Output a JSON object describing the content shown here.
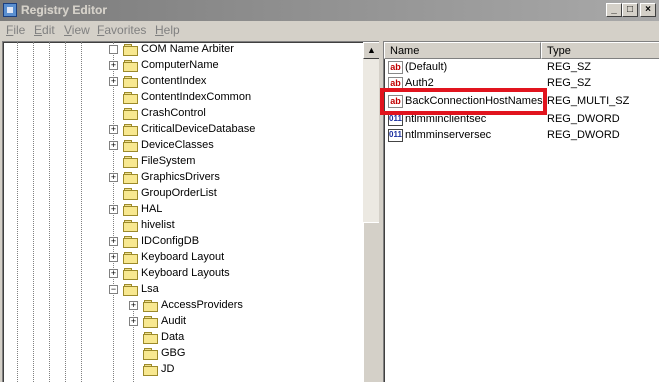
{
  "window": {
    "title": "Registry Editor",
    "controls": [
      "_",
      "□",
      "×"
    ]
  },
  "menu": [
    "File",
    "Edit",
    "View",
    "Favorites",
    "Help"
  ],
  "tree": {
    "items": [
      {
        "label": "COM Name Arbiter",
        "expander": ""
      },
      {
        "label": "ComputerName",
        "expander": "+"
      },
      {
        "label": "ContentIndex",
        "expander": "+"
      },
      {
        "label": "ContentIndexCommon",
        "expander": ""
      },
      {
        "label": "CrashControl",
        "expander": ""
      },
      {
        "label": "CriticalDeviceDatabase",
        "expander": "+"
      },
      {
        "label": "DeviceClasses",
        "expander": "+"
      },
      {
        "label": "FileSystem",
        "expander": ""
      },
      {
        "label": "GraphicsDrivers",
        "expander": "+"
      },
      {
        "label": "GroupOrderList",
        "expander": ""
      },
      {
        "label": "HAL",
        "expander": "+"
      },
      {
        "label": "hivelist",
        "expander": ""
      },
      {
        "label": "IDConfigDB",
        "expander": "+"
      },
      {
        "label": "Keyboard Layout",
        "expander": "+"
      },
      {
        "label": "Keyboard Layouts",
        "expander": "+"
      },
      {
        "label": "Lsa",
        "expander": "−"
      }
    ],
    "children": [
      {
        "label": "AccessProviders",
        "expander": "+"
      },
      {
        "label": "Audit",
        "expander": "+"
      },
      {
        "label": "Data",
        "expander": ""
      },
      {
        "label": "GBG",
        "expander": ""
      },
      {
        "label": "JD",
        "expander": ""
      }
    ]
  },
  "list": {
    "columns": {
      "name": "Name",
      "type": "Type"
    },
    "rows": [
      {
        "icon": "ab",
        "name": "(Default)",
        "type": "REG_SZ"
      },
      {
        "icon": "ab",
        "name": "Auth2",
        "type": "REG_SZ"
      },
      {
        "icon": "ab",
        "name": "BackConnectionHostNames",
        "type": "REG_MULTI_SZ"
      },
      {
        "icon": "dword",
        "name": "ntlmminclientsec",
        "type": "REG_DWORD"
      },
      {
        "icon": "dword",
        "name": "ntlmminserversec",
        "type": "REG_DWORD"
      }
    ],
    "icon_text": {
      "ab": "ab",
      "dword": "011"
    }
  },
  "colors": {
    "highlight": "#e1141e",
    "window_bg": "#d4d0c8"
  }
}
